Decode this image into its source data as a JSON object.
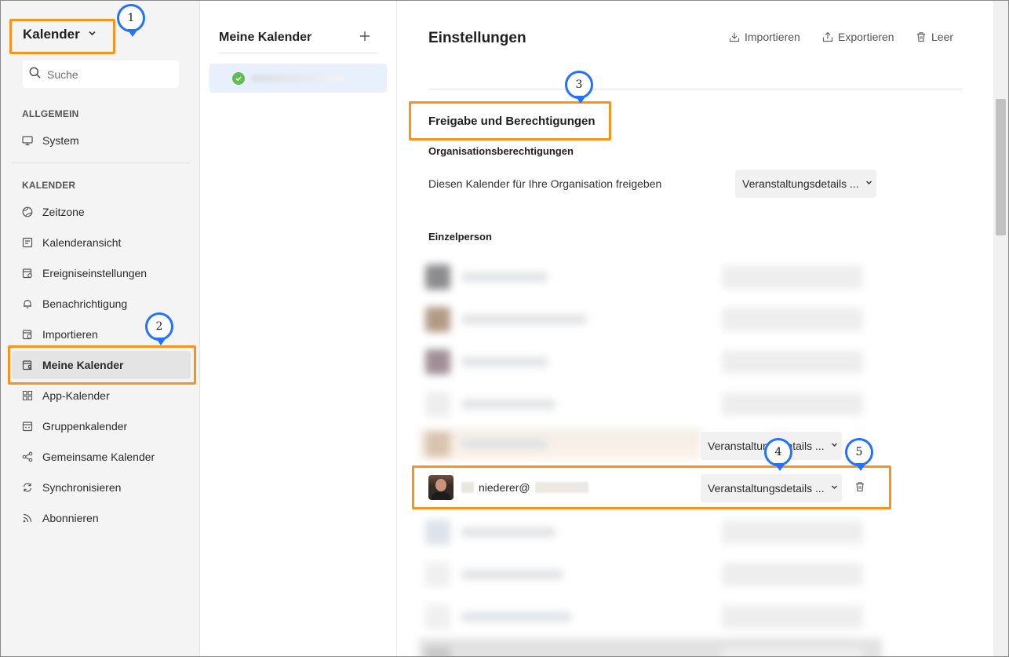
{
  "nav": {
    "app_title": "Kalender",
    "search_placeholder": "Suche",
    "section_general": "ALLGEMEIN",
    "section_calendar": "KALENDER",
    "items": [
      {
        "label": "System",
        "icon": "monitor-icon"
      },
      {
        "label": "Zeitzone",
        "icon": "globe-icon"
      },
      {
        "label": "Kalenderansicht",
        "icon": "calendar-view-icon"
      },
      {
        "label": "Ereigniseinstellungen",
        "icon": "event-settings-icon"
      },
      {
        "label": "Benachrichtigung",
        "icon": "bell-icon"
      },
      {
        "label": "Importieren",
        "icon": "import-icon"
      },
      {
        "label": "Meine Kalender",
        "icon": "my-calendar-icon",
        "active": true
      },
      {
        "label": "App-Kalender",
        "icon": "apps-icon"
      },
      {
        "label": "Gruppenkalender",
        "icon": "group-calendar-icon"
      },
      {
        "label": "Gemeinsame Kalender",
        "icon": "share-icon"
      },
      {
        "label": "Synchronisieren",
        "icon": "sync-icon"
      },
      {
        "label": "Abonnieren",
        "icon": "rss-icon"
      }
    ]
  },
  "calendars": {
    "title": "Meine Kalender",
    "add": "+"
  },
  "settings": {
    "title": "Einstellungen",
    "toolbar": {
      "import": "Importieren",
      "export": "Exportieren",
      "empty": "Leer"
    },
    "sharing_title": "Freigabe und Berechtigungen",
    "org_permissions_title": "Organisationsberechtigungen",
    "org_share_label": "Diesen Kalender für Ihre Organisation freigeben",
    "org_share_value": "Veranstaltungsdetails ...",
    "individual_title": "Einzelperson",
    "row_above_value": "Veranstaltungsdetails ...",
    "active_person": {
      "email_visible": "niederer@",
      "permission": "Veranstaltungsdetails ..."
    }
  },
  "annotations": [
    "1",
    "2",
    "3",
    "4",
    "5"
  ],
  "colors": {
    "highlight": "#f7941d",
    "pin_border": "#2271ff",
    "accent_green": "#5fbd4f",
    "active_bg": "#e8f0fb"
  }
}
